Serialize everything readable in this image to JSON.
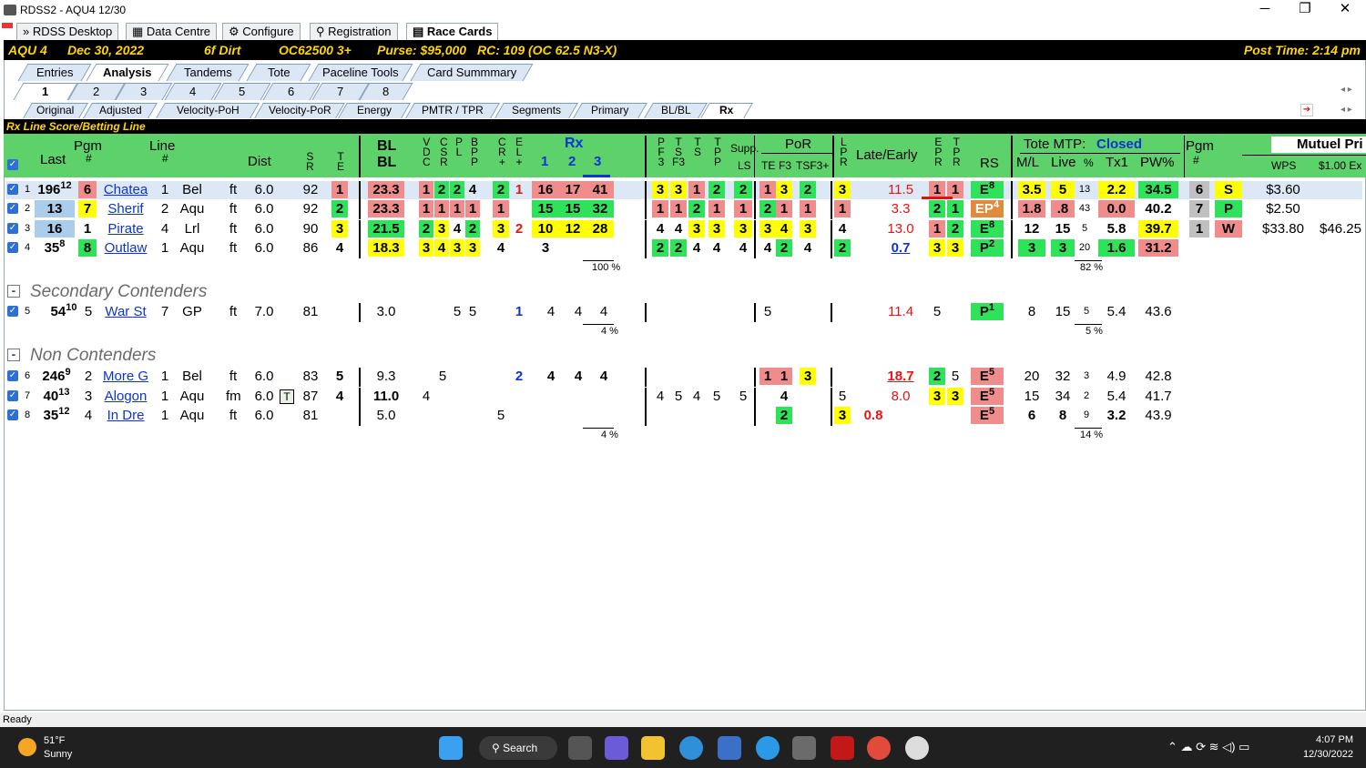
{
  "window": {
    "title": "RDSS2 - AQU4  12/30",
    "min": "─",
    "max": "❐",
    "close": "✕"
  },
  "main_tabs": [
    {
      "label": "RDSS Desktop"
    },
    {
      "label": "Data Centre"
    },
    {
      "label": "Configure"
    },
    {
      "label": "Registration"
    },
    {
      "label": "Race Cards"
    }
  ],
  "race": {
    "track": "AQU 4",
    "date": "Dec 30, 2022",
    "surface": "6f Dirt",
    "class": "OC62500 3+",
    "purse": "Purse: $95,000",
    "rc": "RC: 109 (OC 62.5 N3-X)",
    "post_time": "Post Time: 2:14 pm"
  },
  "view_tabs": [
    "Entries",
    "Analysis",
    "Tandems",
    "Tote",
    "Paceline Tools",
    "Card Summmary"
  ],
  "race_tabs": [
    "1",
    "2",
    "3",
    "4",
    "5",
    "6",
    "7",
    "8"
  ],
  "sub_tabs": [
    "Original",
    "Adjusted",
    "Velocity-PoH",
    "Velocity-PoR",
    "Energy",
    "PMTR / TPR",
    "Segments",
    "Primary",
    "BL/BL",
    "Rx"
  ],
  "panel_title": "Rx Line Score/Betting Line",
  "headers": {
    "last": "Last",
    "pgm": "Pgm",
    "pgm_hash": "#",
    "line": "Line",
    "line_hash": "#",
    "dist": "Dist",
    "sr": "S\nR",
    "te": "T\nE",
    "blbl1": "BL",
    "blbl2": "BL",
    "vdc": "V\nD\nC",
    "csr": "C\nS\nR",
    "pl": "P\nL",
    "bp": "B\nP\nP",
    "cr": "C\nR\n+",
    "el": "E\nL\n+",
    "rx": "Rx",
    "rx1": "1",
    "rx2": "2",
    "rx3": "3",
    "pf3": "P\nF\n3",
    "tsf3": "T\nS\nF3",
    "ts": "T\nS",
    "tp": "T\nP\nP",
    "supp": "Supp.",
    "ls": "LS",
    "por": "PoR",
    "te2": "TE",
    "f3": "F3",
    "tsf3p": "TSF3+",
    "lpr": "L\nP\nR",
    "late_early": "Late/Early",
    "epr": "E\nP\nR",
    "tpr": "T\nP\nR",
    "rs": "RS",
    "tote_mtp": "Tote MTP:",
    "tote_status": "Closed",
    "ml": "M/L",
    "live": "Live",
    "pctl": "%",
    "tx1": "Tx1",
    "pw": "PW%",
    "pgm2": "Pgm",
    "pgm2h": "#",
    "mutuel": "Mutuel Pri",
    "wps": "WPS",
    "ex": "$1.00 Ex"
  },
  "contenders": [
    {
      "n": "1",
      "last": "196",
      "lsup": "12",
      "pgm": "6",
      "name": "Chatea",
      "line": "1",
      "trk": "Bel",
      "sf": "ft",
      "dist": "6.0",
      "sr": "92",
      "te": "1",
      "bl": "23.3",
      "v": "1",
      "c": "2",
      "p": "2",
      "bp": "4",
      "cr": "2",
      "el": "1",
      "r1": "16",
      "r2": "17",
      "r3": "41",
      "pf": "3",
      "tsf": "3",
      "ts": "1",
      "tp": "2",
      "ls": "2",
      "te2": "1",
      "f3": "3",
      "tsf3": "2",
      "lpr": "3",
      "late": "11.5",
      "epr": "1",
      "tpr": "1",
      "rs": "E",
      "rss": "8",
      "ml": "3.5",
      "live": "5",
      "pct": "13",
      "tx": "2.2",
      "pw": "34.5",
      "p2": "6",
      "wps": "S",
      "pay": "$3.60",
      "ex": ""
    },
    {
      "n": "2",
      "last": "13",
      "lsup": "",
      "pgm": "7",
      "name": "Sherif",
      "line": "2",
      "trk": "Aqu",
      "sf": "ft",
      "dist": "6.0",
      "sr": "92",
      "te": "2",
      "bl": "23.3",
      "v": "1",
      "c": "1",
      "p": "1",
      "bp": "1",
      "cr": "1",
      "el": "",
      "r1": "15",
      "r2": "15",
      "r3": "32",
      "pf": "1",
      "tsf": "1",
      "ts": "2",
      "tp": "1",
      "ls": "1",
      "te2": "2",
      "f3": "1",
      "tsf3": "1",
      "lpr": "1",
      "late": "3.3",
      "epr": "2",
      "tpr": "1",
      "rs": "EP",
      "rss": "4",
      "ml": "1.8",
      "live": ".8",
      "pct": "43",
      "tx": "0.0",
      "pw": "40.2",
      "p2": "7",
      "wps": "P",
      "pay": "$2.50",
      "ex": ""
    },
    {
      "n": "3",
      "last": "16",
      "lsup": "",
      "pgm": "1",
      "name": "Pirate",
      "line": "4",
      "trk": "Lrl",
      "sf": "ft",
      "dist": "6.0",
      "sr": "90",
      "te": "3",
      "bl": "21.5",
      "v": "2",
      "c": "3",
      "p": "4",
      "bp": "2",
      "cr": "3",
      "el": "2",
      "r1": "10",
      "r2": "12",
      "r3": "28",
      "pf": "4",
      "tsf": "4",
      "ts": "3",
      "tp": "3",
      "ls": "3",
      "te2": "3",
      "f3": "4",
      "tsf3": "3",
      "lpr": "4",
      "late": "13.0",
      "epr": "1",
      "tpr": "2",
      "rs": "E",
      "rss": "8",
      "ml": "12",
      "live": "15",
      "pct": "5",
      "tx": "5.8",
      "pw": "39.7",
      "p2": "1",
      "wps": "W",
      "pay": "$33.80",
      "ex": "$46.25"
    },
    {
      "n": "4",
      "last": "35",
      "lsup": "8",
      "pgm": "8",
      "name": "Outlaw",
      "line": "1",
      "trk": "Aqu",
      "sf": "ft",
      "dist": "6.0",
      "sr": "86",
      "te": "4",
      "bl": "18.3",
      "v": "3",
      "c": "4",
      "p": "3",
      "bp": "3",
      "cr": "4",
      "el": "",
      "r1": "3",
      "r2": "",
      "r3": "",
      "pf": "2",
      "tsf": "2",
      "ts": "4",
      "tp": "4",
      "ls": "4",
      "te2": "4",
      "f3": "2",
      "tsf3": "4",
      "lpr": "2",
      "late": "0.7",
      "epr": "3",
      "tpr": "3",
      "rs": "P",
      "rss": "2",
      "ml": "3",
      "live": "3",
      "pct": "20",
      "tx": "1.6",
      "pw": "31.2",
      "p2": "",
      "wps": "",
      "pay": "",
      "ex": ""
    }
  ],
  "contender_pct": "100 %",
  "contender_pct2": "82 %",
  "secondary_title": "Secondary Contenders",
  "secondary": [
    {
      "n": "5",
      "last": "54",
      "lsup": "10",
      "pgm": "5",
      "name": "War St",
      "line": "7",
      "trk": "GP",
      "sf": "ft",
      "dist": "7.0",
      "sr": "81",
      "bl": "3.0",
      "p": "5",
      "bp": "5",
      "el": "1",
      "r0": "4",
      "r1": "4",
      "r2": "4",
      "te2": "5",
      "late": "11.4",
      "epr": "5",
      "rs": "P",
      "rss": "1",
      "ml": "8",
      "live": "15",
      "pct": "5",
      "tx": "5.4",
      "pw": "43.6"
    }
  ],
  "secondary_pct": "4 %",
  "secondary_pct2": "5 %",
  "non_title": "Non Contenders",
  "non": [
    {
      "n": "6",
      "last": "246",
      "lsup": "9",
      "pgm": "2",
      "name": "More G",
      "line": "1",
      "trk": "Bel",
      "sf": "ft",
      "dist": "6.0",
      "sr": "83",
      "te": "5",
      "bl": "9.3",
      "v": "5",
      "el": "2",
      "r0": "4",
      "r1": "4",
      "r2": "4",
      "te2": "1",
      "f3": "1",
      "tsf3": "3",
      "late": "18.7",
      "epr": "2",
      "tpr": "5",
      "rs": "E",
      "rss": "5",
      "ml": "20",
      "live": "32",
      "pct": "3",
      "tx": "4.9",
      "pw": "42.8"
    },
    {
      "n": "7",
      "last": "40",
      "lsup": "13",
      "pgm": "3",
      "name": "Alogon",
      "line": "1",
      "trk": "Aqu",
      "sf": "fm",
      "dist": "6.0",
      "turf": "T",
      "sr": "87",
      "te": "4",
      "bl": "11.0",
      "v": "4",
      "pf": "4",
      "tsf": "5",
      "ts": "4",
      "tp": "5",
      "ls": "5",
      "f3": "4",
      "lpr": "5",
      "late": "8.0",
      "epr": "3",
      "tpr": "3",
      "rs": "E",
      "rss": "5",
      "ml": "15",
      "live": "34",
      "pct": "2",
      "tx": "5.4",
      "pw": "41.7"
    },
    {
      "n": "8",
      "last": "35",
      "lsup": "12",
      "pgm": "4",
      "name": "In Dre",
      "line": "1",
      "trk": "Aqu",
      "sf": "ft",
      "dist": "6.0",
      "sr": "81",
      "bl": "5.0",
      "cr": "5",
      "f3": "2",
      "lpr": "3",
      "lpr2": "0.8",
      "rs": "E",
      "rss": "5",
      "ml": "6",
      "live": "8",
      "pct": "9",
      "tx": "3.2",
      "pw": "43.9"
    }
  ],
  "non_pct": "4 %",
  "non_pct2": "14 %",
  "status": "Ready",
  "taskbar": {
    "temp": "51°F",
    "weather": "Sunny",
    "search": "Search",
    "time": "4:07 PM",
    "date": "12/30/2022"
  }
}
